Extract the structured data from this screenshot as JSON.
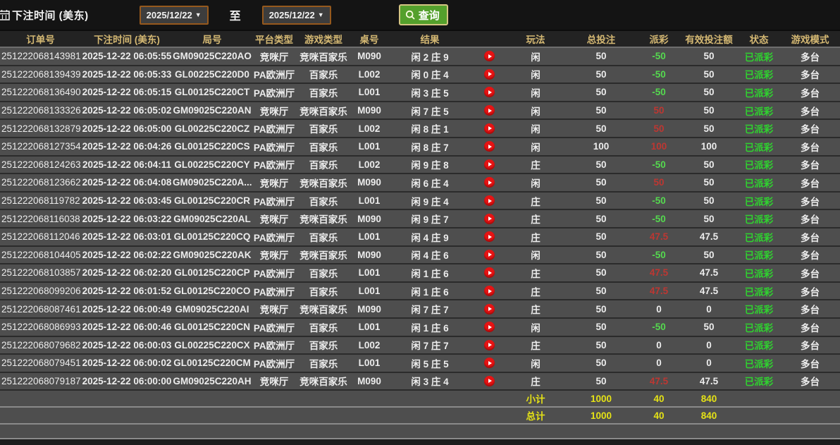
{
  "filter_bar": {
    "label": "下注时间 (美东)",
    "date_from": "2025/12/22",
    "to_label": "至",
    "date_to": "2025/12/22",
    "query_button": "查询"
  },
  "table": {
    "headers": [
      "订单号",
      "下注时间 (美东)",
      "局号",
      "平台类型",
      "游戏类型",
      "桌号",
      "结果",
      "",
      "玩法",
      "总投注",
      "派彩",
      "有效投注额",
      "状态",
      "游戏模式"
    ],
    "rows": [
      {
        "order": "251222068143981",
        "time": "2025-12-22 06:05:55",
        "round": "GM09025C220AO",
        "platform": "竞咪厅",
        "game": "竞咪百家乐",
        "table": "M090",
        "result": "闲 2 庄 9",
        "bet": "闲",
        "total": "50",
        "payout": "-50",
        "valid": "50",
        "status": "已派彩",
        "mode": "多台"
      },
      {
        "order": "251222068139439",
        "time": "2025-12-22 06:05:33",
        "round": "GL00225C220D0",
        "platform": "PA欧洲厅",
        "game": "百家乐",
        "table": "L002",
        "result": "闲 0 庄 4",
        "bet": "闲",
        "total": "50",
        "payout": "-50",
        "valid": "50",
        "status": "已派彩",
        "mode": "多台"
      },
      {
        "order": "251222068136490",
        "time": "2025-12-22 06:05:15",
        "round": "GL00125C220CT",
        "platform": "PA欧洲厅",
        "game": "百家乐",
        "table": "L001",
        "result": "闲 3 庄 5",
        "bet": "闲",
        "total": "50",
        "payout": "-50",
        "valid": "50",
        "status": "已派彩",
        "mode": "多台"
      },
      {
        "order": "251222068133326",
        "time": "2025-12-22 06:05:02",
        "round": "GM09025C220AN",
        "platform": "竞咪厅",
        "game": "竞咪百家乐",
        "table": "M090",
        "result": "闲 7 庄 5",
        "bet": "闲",
        "total": "50",
        "payout": "50",
        "valid": "50",
        "status": "已派彩",
        "mode": "多台"
      },
      {
        "order": "251222068132879",
        "time": "2025-12-22 06:05:00",
        "round": "GL00225C220CZ",
        "platform": "PA欧洲厅",
        "game": "百家乐",
        "table": "L002",
        "result": "闲 8 庄 1",
        "bet": "闲",
        "total": "50",
        "payout": "50",
        "valid": "50",
        "status": "已派彩",
        "mode": "多台"
      },
      {
        "order": "251222068127354",
        "time": "2025-12-22 06:04:26",
        "round": "GL00125C220CS",
        "platform": "PA欧洲厅",
        "game": "百家乐",
        "table": "L001",
        "result": "闲 8 庄 7",
        "bet": "闲",
        "total": "100",
        "payout": "100",
        "valid": "100",
        "status": "已派彩",
        "mode": "多台"
      },
      {
        "order": "251222068124263",
        "time": "2025-12-22 06:04:11",
        "round": "GL00225C220CY",
        "platform": "PA欧洲厅",
        "game": "百家乐",
        "table": "L002",
        "result": "闲 9 庄 8",
        "bet": "庄",
        "total": "50",
        "payout": "-50",
        "valid": "50",
        "status": "已派彩",
        "mode": "多台"
      },
      {
        "order": "251222068123662",
        "time": "2025-12-22 06:04:08",
        "round": "GM09025C220A...",
        "platform": "竞咪厅",
        "game": "竞咪百家乐",
        "table": "M090",
        "result": "闲 6 庄 4",
        "bet": "闲",
        "total": "50",
        "payout": "50",
        "valid": "50",
        "status": "已派彩",
        "mode": "多台"
      },
      {
        "order": "251222068119782",
        "time": "2025-12-22 06:03:45",
        "round": "GL00125C220CR",
        "platform": "PA欧洲厅",
        "game": "百家乐",
        "table": "L001",
        "result": "闲 9 庄 4",
        "bet": "庄",
        "total": "50",
        "payout": "-50",
        "valid": "50",
        "status": "已派彩",
        "mode": "多台"
      },
      {
        "order": "251222068116038",
        "time": "2025-12-22 06:03:22",
        "round": "GM09025C220AL",
        "platform": "竞咪厅",
        "game": "竞咪百家乐",
        "table": "M090",
        "result": "闲 9 庄 7",
        "bet": "庄",
        "total": "50",
        "payout": "-50",
        "valid": "50",
        "status": "已派彩",
        "mode": "多台"
      },
      {
        "order": "251222068112046",
        "time": "2025-12-22 06:03:01",
        "round": "GL00125C220CQ",
        "platform": "PA欧洲厅",
        "game": "百家乐",
        "table": "L001",
        "result": "闲 4 庄 9",
        "bet": "庄",
        "total": "50",
        "payout": "47.5",
        "valid": "47.5",
        "status": "已派彩",
        "mode": "多台"
      },
      {
        "order": "251222068104405",
        "time": "2025-12-22 06:02:22",
        "round": "GM09025C220AK",
        "platform": "竞咪厅",
        "game": "竞咪百家乐",
        "table": "M090",
        "result": "闲 4 庄 6",
        "bet": "闲",
        "total": "50",
        "payout": "-50",
        "valid": "50",
        "status": "已派彩",
        "mode": "多台"
      },
      {
        "order": "251222068103857",
        "time": "2025-12-22 06:02:20",
        "round": "GL00125C220CP",
        "platform": "PA欧洲厅",
        "game": "百家乐",
        "table": "L001",
        "result": "闲 1 庄 6",
        "bet": "庄",
        "total": "50",
        "payout": "47.5",
        "valid": "47.5",
        "status": "已派彩",
        "mode": "多台"
      },
      {
        "order": "251222068099206",
        "time": "2025-12-22 06:01:52",
        "round": "GL00125C220CO",
        "platform": "PA欧洲厅",
        "game": "百家乐",
        "table": "L001",
        "result": "闲 1 庄 6",
        "bet": "庄",
        "total": "50",
        "payout": "47.5",
        "valid": "47.5",
        "status": "已派彩",
        "mode": "多台"
      },
      {
        "order": "251222068087461",
        "time": "2025-12-22 06:00:49",
        "round": "GM09025C220AI",
        "platform": "竞咪厅",
        "game": "竞咪百家乐",
        "table": "M090",
        "result": "闲 7 庄 7",
        "bet": "庄",
        "total": "50",
        "payout": "0",
        "valid": "0",
        "status": "已派彩",
        "mode": "多台"
      },
      {
        "order": "251222068086993",
        "time": "2025-12-22 06:00:46",
        "round": "GL00125C220CN",
        "platform": "PA欧洲厅",
        "game": "百家乐",
        "table": "L001",
        "result": "闲 1 庄 6",
        "bet": "闲",
        "total": "50",
        "payout": "-50",
        "valid": "50",
        "status": "已派彩",
        "mode": "多台"
      },
      {
        "order": "251222068079682",
        "time": "2025-12-22 06:00:03",
        "round": "GL00225C220CX",
        "platform": "PA欧洲厅",
        "game": "百家乐",
        "table": "L002",
        "result": "闲 7 庄 7",
        "bet": "庄",
        "total": "50",
        "payout": "0",
        "valid": "0",
        "status": "已派彩",
        "mode": "多台"
      },
      {
        "order": "251222068079451",
        "time": "2025-12-22 06:00:02",
        "round": "GL00125C220CM",
        "platform": "PA欧洲厅",
        "game": "百家乐",
        "table": "L001",
        "result": "闲 5 庄 5",
        "bet": "闲",
        "total": "50",
        "payout": "0",
        "valid": "0",
        "status": "已派彩",
        "mode": "多台"
      },
      {
        "order": "251222068079187",
        "time": "2025-12-22 06:00:00",
        "round": "GM09025C220AH",
        "platform": "竞咪厅",
        "game": "竞咪百家乐",
        "table": "M090",
        "result": "闲 3 庄 4",
        "bet": "庄",
        "total": "50",
        "payout": "47.5",
        "valid": "47.5",
        "status": "已派彩",
        "mode": "多台"
      }
    ],
    "summary": [
      {
        "label": "小计",
        "total": "1000",
        "payout": "40",
        "valid": "840"
      },
      {
        "label": "总计",
        "total": "1000",
        "payout": "40",
        "valid": "840"
      }
    ]
  },
  "colors": {
    "payout_negative_green": "#55d94f",
    "payout_positive_red": "#bd3732",
    "status_green": "#2fd32f",
    "summary_yellow": "#e5e216",
    "header_gold": "#d4b873",
    "date_border_brown": "#96591d",
    "query_green": "#54a02c",
    "play_red": "#e61414"
  }
}
